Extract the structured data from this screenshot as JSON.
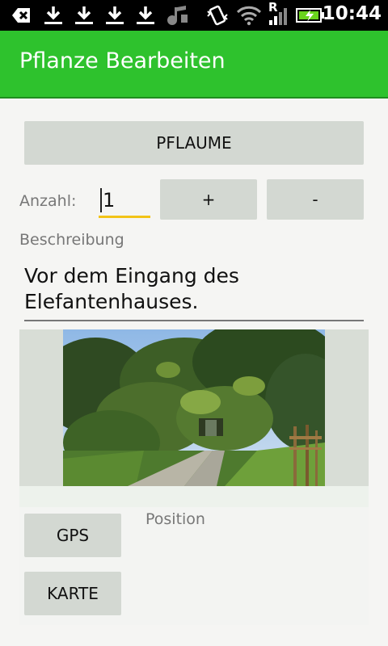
{
  "status_bar": {
    "time": "10:44",
    "signal_letter": "R",
    "icons": [
      "usb-debug-icon",
      "download-icon",
      "download-icon",
      "download-icon",
      "download-icon",
      "music-icon",
      "vibrate-icon",
      "wifi-icon",
      "signal-icon",
      "battery-charging-icon"
    ]
  },
  "action_bar": {
    "title": "Pflanze Bearbeiten",
    "color": "#2ec22d"
  },
  "form": {
    "plant_button_label": "PFLAUME",
    "quantity_label": "Anzahl:",
    "quantity_value": "1",
    "plus_label": "+",
    "minus_label": "-",
    "description_label": "Beschreibung",
    "description_value": "Vor dem Eingang des Elefantenhauses.",
    "position_label": "Position",
    "gps_button_label": "GPS",
    "map_button_label": "KARTE"
  },
  "colors": {
    "button_bg": "#d3d8d2",
    "input_underline": "#f2c316"
  }
}
